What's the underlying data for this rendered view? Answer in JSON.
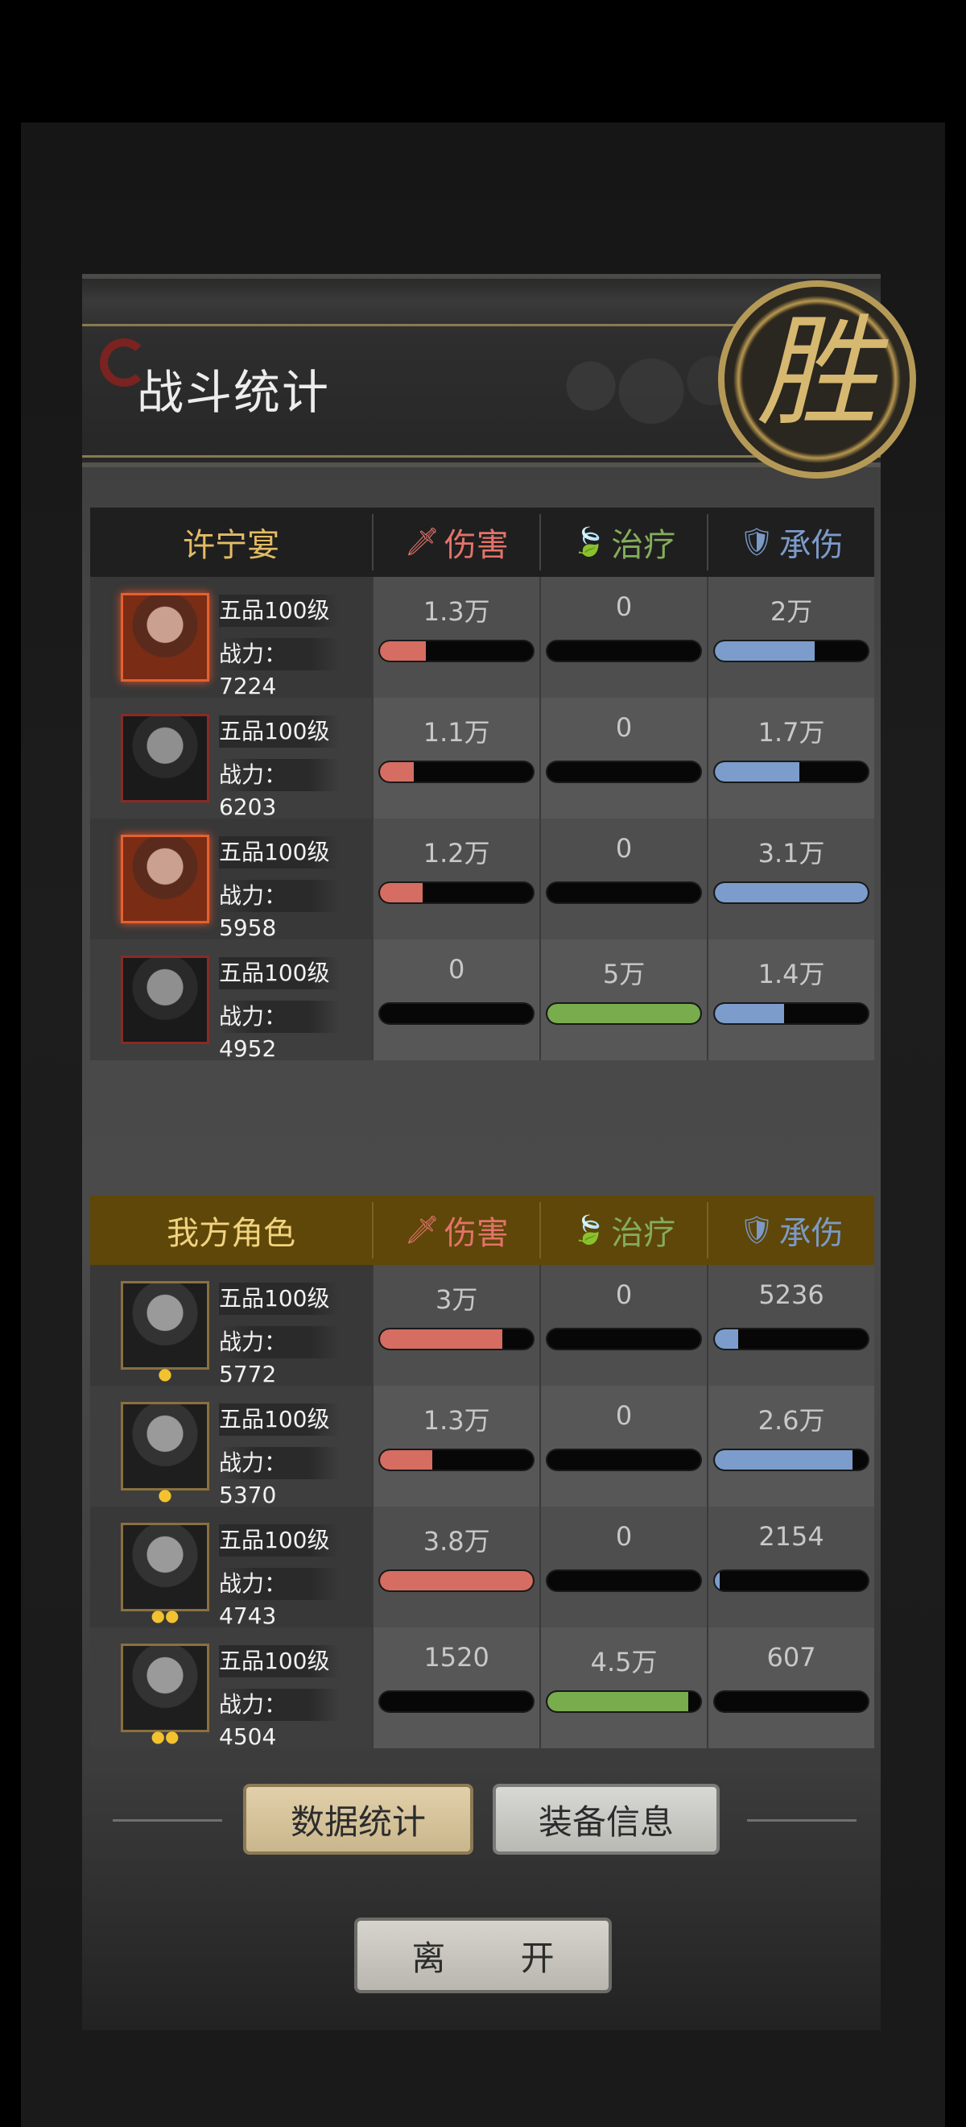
{
  "title": "战斗统计",
  "victory": "胜",
  "headers": {
    "damage": "伤害",
    "healing": "治疗",
    "tank": "承伤"
  },
  "colors": {
    "damage": "#d66d62",
    "healing": "#78ac4c",
    "tank": "#7c9dcc",
    "gold": "#e3bb64"
  },
  "enemy": {
    "name": "许宁宴",
    "rows": [
      {
        "rank": "五品100级",
        "power": "战力：7224",
        "damage": "1.3万",
        "damage_pct": 0.3,
        "healing": "0",
        "healing_pct": 0,
        "tank": "2万",
        "tank_pct": 0.65
      },
      {
        "rank": "五品100级",
        "power": "战力：6203",
        "damage": "1.1万",
        "damage_pct": 0.22,
        "healing": "0",
        "healing_pct": 0,
        "tank": "1.7万",
        "tank_pct": 0.55
      },
      {
        "rank": "五品100级",
        "power": "战力：5958",
        "damage": "1.2万",
        "damage_pct": 0.28,
        "healing": "0",
        "healing_pct": 0,
        "tank": "3.1万",
        "tank_pct": 1.0
      },
      {
        "rank": "五品100级",
        "power": "战力：4952",
        "damage": "0",
        "damage_pct": 0,
        "healing": "5万",
        "healing_pct": 1.0,
        "tank": "1.4万",
        "tank_pct": 0.45
      }
    ]
  },
  "ally": {
    "name": "我方角色",
    "rows": [
      {
        "rank": "五品100级",
        "power": "战力：5772",
        "damage": "3万",
        "damage_pct": 0.8,
        "healing": "0",
        "healing_pct": 0,
        "tank": "5236",
        "tank_pct": 0.15
      },
      {
        "rank": "五品100级",
        "power": "战力：5370",
        "damage": "1.3万",
        "damage_pct": 0.34,
        "healing": "0",
        "healing_pct": 0,
        "tank": "2.6万",
        "tank_pct": 0.9
      },
      {
        "rank": "五品100级",
        "power": "战力：4743",
        "damage": "3.8万",
        "damage_pct": 1.0,
        "healing": "0",
        "healing_pct": 0,
        "tank": "2154",
        "tank_pct": 0.03
      },
      {
        "rank": "五品100级",
        "power": "战力：4504",
        "damage": "1520",
        "damage_pct": 0,
        "healing": "4.5万",
        "healing_pct": 0.92,
        "tank": "607",
        "tank_pct": 0
      }
    ]
  },
  "buttons": {
    "stats": "数据统计",
    "equipment": "装备信息",
    "leave": "离 开"
  }
}
